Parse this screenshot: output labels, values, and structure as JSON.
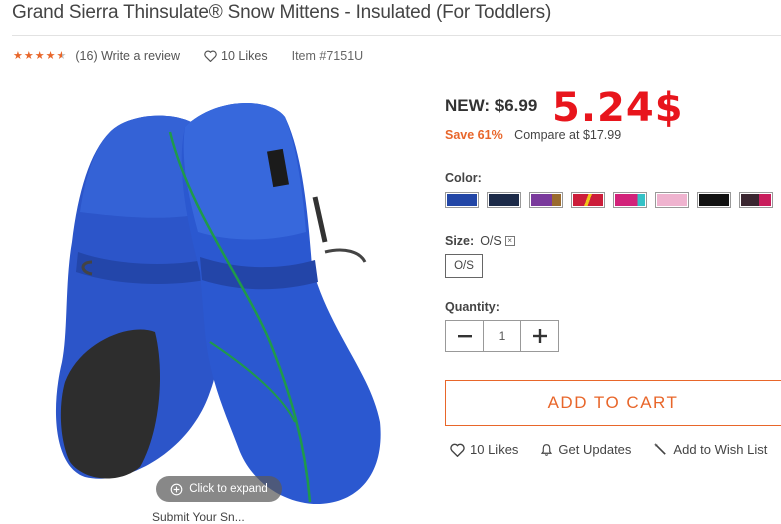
{
  "product": {
    "title": "Grand Sierra Thinsulate® Snow Mittens - Insulated (For Toddlers)",
    "reviews_text": "(16) Write a review",
    "rating_stars": 4.5,
    "likes_text": "10 Likes",
    "item_number": "Item #7151U"
  },
  "image": {
    "expand_label": "Click to expand",
    "below_text": "Submit Your Sn..."
  },
  "pricing": {
    "new_price": "NEW: $6.99",
    "overlay_price": "5.24$",
    "save_text": "Save 61%",
    "compare_text": "Compare at $17.99"
  },
  "color": {
    "label": "Color:",
    "swatches": [
      "#2246a6",
      "#1c2a48",
      "#7a3a9c",
      "#cc1d3a",
      "#d2227a",
      "#efb3cf",
      "#111111",
      "#3a2630"
    ]
  },
  "size": {
    "label": "Size:",
    "value": "O/S",
    "option": "O/S"
  },
  "quantity": {
    "label": "Quantity:",
    "value": "1",
    "minus": "−",
    "plus": "+"
  },
  "cart": {
    "button_label": "ADD TO CART"
  },
  "actions": {
    "likes": "10 Likes",
    "updates": "Get Updates",
    "wishlist": "Add to Wish List"
  }
}
